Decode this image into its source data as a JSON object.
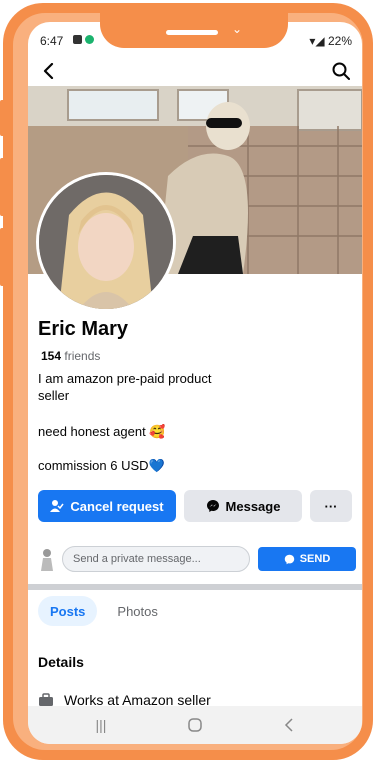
{
  "status": {
    "time": "6:47",
    "battery": "22%"
  },
  "profile": {
    "name": "Eric Mary",
    "friends_count": "154",
    "friends_label": "friends",
    "bio_lines": [
      "I am amazon pre-paid product",
      " seller",
      "need honest agent 🥰",
      "commission 6 USD💙"
    ]
  },
  "actions": {
    "cancel_request": "Cancel request",
    "message": "Message",
    "more": "···"
  },
  "message_bar": {
    "placeholder": "Send a private message...",
    "send": "SEND"
  },
  "tabs": [
    {
      "label": "Posts",
      "active": true
    },
    {
      "label": "Photos",
      "active": false
    }
  ],
  "details": {
    "title": "Details",
    "works_at": "Works at Amazon seller"
  },
  "colors": {
    "frame": "#F58E4A",
    "primary": "#1877F2",
    "secondary": "#e4e6eb"
  },
  "icons": {
    "back": "back-arrow-icon",
    "search": "search-icon",
    "add_friend": "person-check-icon",
    "messenger": "messenger-icon",
    "briefcase": "briefcase-icon"
  }
}
